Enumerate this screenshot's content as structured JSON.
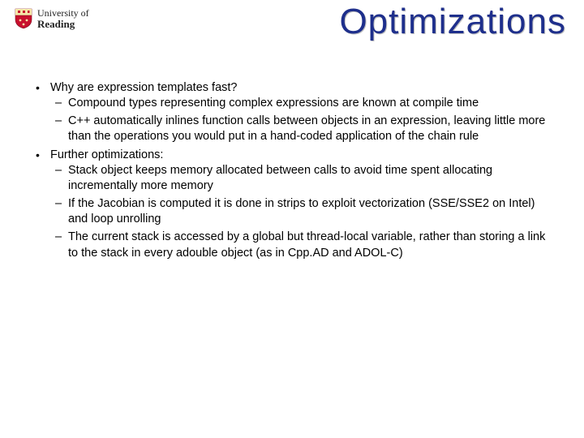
{
  "logo": {
    "line1": "University of",
    "line2": "Reading"
  },
  "title": "Optimizations",
  "bullets": [
    {
      "heading": "Why are expression templates fast?",
      "subs": [
        "Compound types representing complex expressions are known at compile time",
        "C++ automatically inlines function calls between objects in an expression, leaving little more than the operations you would put in a hand-coded application of the chain rule"
      ]
    },
    {
      "heading": "Further optimizations:",
      "subs": [
        "Stack object keeps memory allocated between calls to avoid time spent allocating incrementally more memory",
        "If the Jacobian is computed it is done in strips to exploit vectorization (SSE/SSE2 on Intel) and loop unrolling",
        "The current stack is accessed by a global but thread-local variable, rather than storing a link to the stack in every adouble object (as in Cpp.AD and ADOL-C)"
      ]
    }
  ]
}
